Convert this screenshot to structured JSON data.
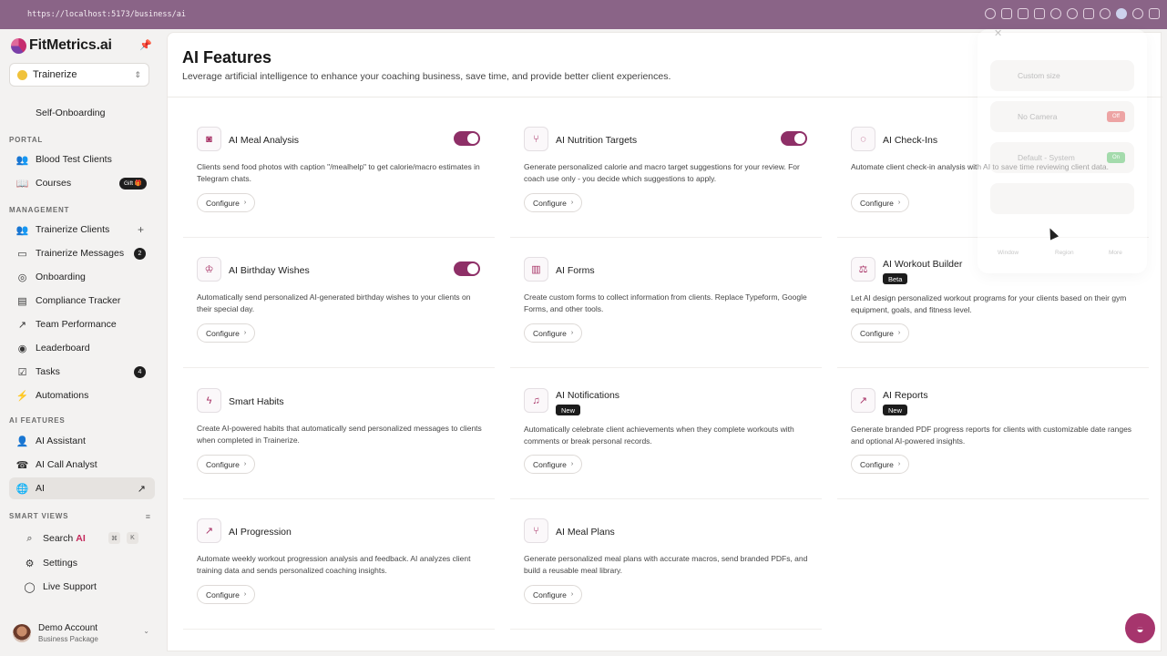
{
  "browser": {
    "url": "https://localhost:5173/business/ai"
  },
  "brand": {
    "name": "FitMetrics.ai"
  },
  "workspace": {
    "name": "Trainerize"
  },
  "sidebar": {
    "self_onboarding": "Self-Onboarding",
    "portal_label": "PORTAL",
    "portal": [
      {
        "label": "Blood Test Clients",
        "icon": "blood-drop-icon"
      },
      {
        "label": "Courses",
        "icon": "book-icon",
        "badge": "Gift 🎁"
      }
    ],
    "management_label": "MANAGEMENT",
    "management": [
      {
        "label": "Trainerize Clients",
        "icon": "users-icon"
      },
      {
        "label": "Trainerize Messages",
        "icon": "message-icon",
        "badge": "2"
      },
      {
        "label": "Onboarding",
        "icon": "check-circle-icon"
      },
      {
        "label": "Compliance Tracker",
        "icon": "tracker-icon"
      },
      {
        "label": "Team Performance",
        "icon": "trend-icon"
      },
      {
        "label": "Leaderboard",
        "icon": "target-icon"
      },
      {
        "label": "Tasks",
        "icon": "checkbox-icon",
        "badge": "4"
      },
      {
        "label": "Automations",
        "icon": "bolt-icon"
      }
    ],
    "ai_label": "AI FEATURES",
    "ai": [
      {
        "label": "AI Assistant",
        "icon": "user-icon"
      },
      {
        "label": "AI Call Analyst",
        "icon": "phone-icon"
      },
      {
        "label": "AI",
        "icon": "globe-icon"
      }
    ],
    "smart_label": "SMART VIEWS",
    "search_label": "Search",
    "search_accent": "AI",
    "kbd_cmd": "⌘",
    "kbd_k": "K",
    "settings_label": "Settings",
    "support_label": "Live Support"
  },
  "account": {
    "name": "Demo Account",
    "plan": "Business Package"
  },
  "page": {
    "title": "AI Features",
    "subtitle": "Leverage artificial intelligence to enhance your coaching business, save time, and provide better client experiences."
  },
  "configure_label": "Configure",
  "cards": [
    {
      "title": "AI Meal Analysis",
      "icon": "camera-icon",
      "desc": "Clients send food photos with caption \"/mealhelp\" to get calorie/macro estimates in Telegram chats.",
      "toggle": true
    },
    {
      "title": "AI Nutrition Targets",
      "icon": "fork-icon",
      "desc": "Generate personalized calorie and macro target suggestions for your review. For coach use only - you decide which suggestions to apply.",
      "toggle": true
    },
    {
      "title": "AI Check-Ins",
      "icon": "chat-icon",
      "desc": "Automate client check-in analysis with AI to save time reviewing client data."
    },
    {
      "title": "AI Birthday Wishes",
      "icon": "cake-icon",
      "desc": "Automatically send personalized AI-generated birthday wishes to your clients on their special day.",
      "toggle": true
    },
    {
      "title": "AI Forms",
      "icon": "document-icon",
      "desc": "Create custom forms to collect information from clients. Replace Typeform, Google Forms, and other tools."
    },
    {
      "title": "AI Workout Builder",
      "icon": "dumbbell-icon",
      "tag": "Beta",
      "desc": "Let AI design personalized workout programs for your clients based on their gym equipment, goals, and fitness level."
    },
    {
      "title": "Smart Habits",
      "icon": "bolt-icon",
      "desc": "Create AI-powered habits that automatically send personalized messages to clients when completed in Trainerize."
    },
    {
      "title": "AI Notifications",
      "icon": "bell-icon",
      "tag": "New",
      "desc": "Automatically celebrate client achievements when they complete workouts with comments or break personal records."
    },
    {
      "title": "AI Reports",
      "icon": "trend-icon",
      "tag": "New",
      "desc": "Generate branded PDF progress reports for clients with customizable date ranges and optional AI-powered insights."
    },
    {
      "title": "AI Progression",
      "icon": "trend-icon",
      "desc": "Automate weekly workout progression analysis and feedback. AI analyzes client training data and sends personalized coaching insights."
    },
    {
      "title": "AI Meal Plans",
      "icon": "utensils-icon",
      "desc": "Generate personalized meal plans with accurate macros, send branded PDFs, and build a reusable meal library."
    }
  ],
  "overlay": {
    "row1": "Custom size",
    "row2": "No Camera",
    "row2_pill": "Off",
    "row3": "Default - System",
    "row3_pill": "On",
    "tab1": "Window",
    "tab2": "Region",
    "tab3": "More"
  },
  "colors": {
    "accent": "#a6356d",
    "toggle": "#8e2f67",
    "chrome": "#8a6487"
  }
}
